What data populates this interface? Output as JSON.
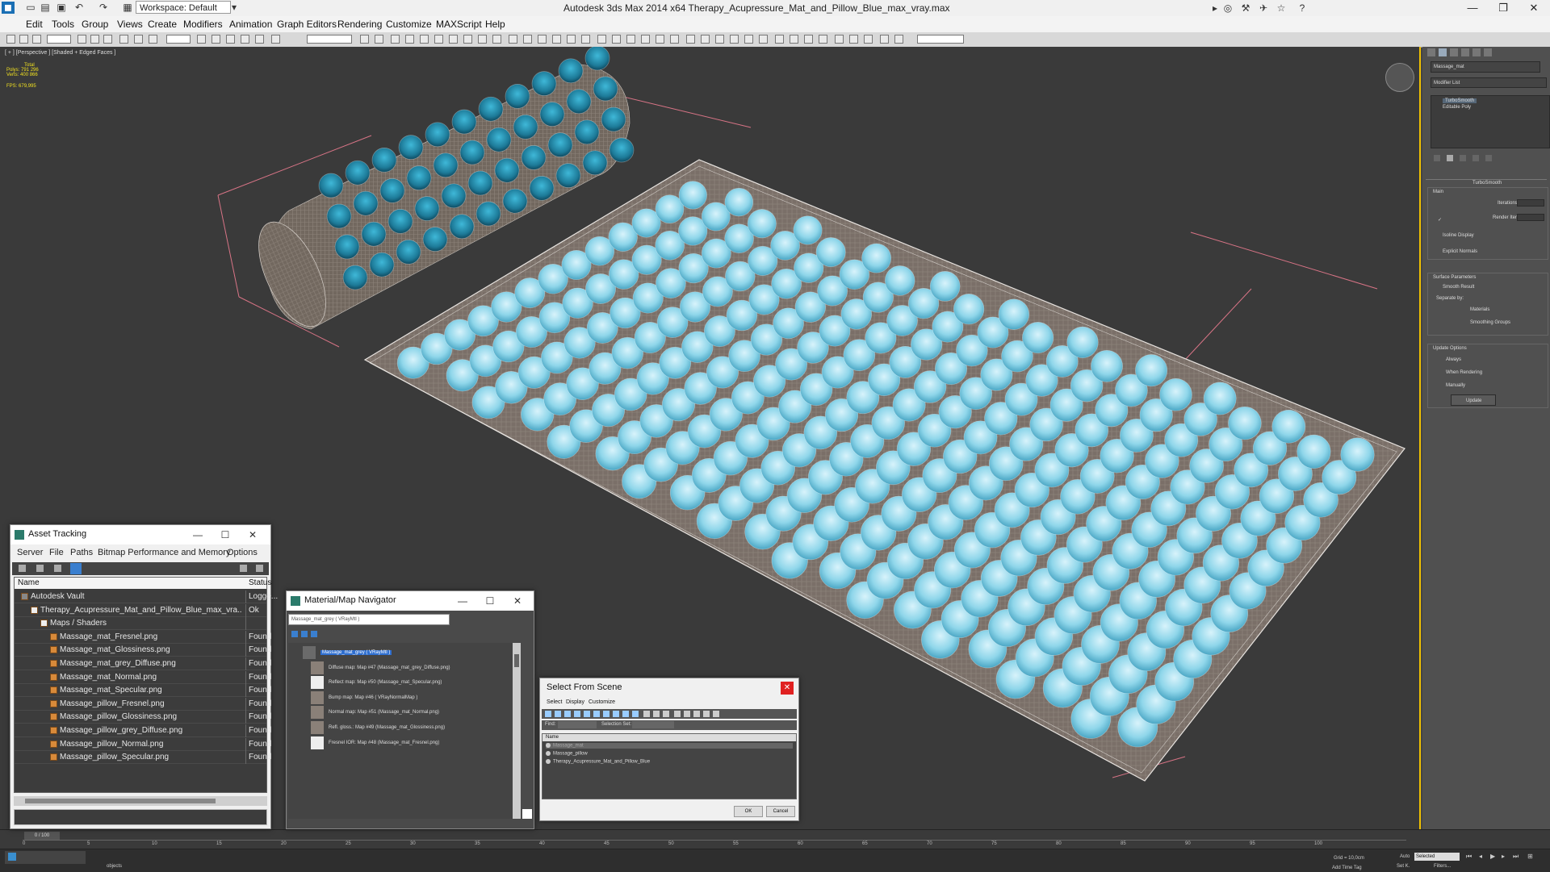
{
  "app": {
    "title": "Autodesk 3ds Max  2014 x64     Therapy_Acupressure_Mat_and_Pillow_Blue_max_vray.max",
    "workspace": "Workspace: Default"
  },
  "menu": [
    "Edit",
    "Tools",
    "Group",
    "Views",
    "Create",
    "Modifiers",
    "Animation",
    "Graph Editors",
    "Rendering",
    "Customize",
    "MAXScript",
    "Help"
  ],
  "viewport": {
    "label": "[ + ] [Perspective ] [Shaded + Edged Faces ]",
    "stats": {
      "total_label": "Total",
      "polys_label": "Polys:",
      "polys": "791 296",
      "verts_label": "Verts:",
      "verts": "400 866",
      "fps_label": "FPS:",
      "fps": "679,995"
    },
    "colors": {
      "bg": "#3a3a3a",
      "spike": "#7fd3e8",
      "fabric": "#7d726a",
      "bbox": "#e07a8a"
    }
  },
  "right_panel": {
    "object_name": "Massage_mat",
    "modifier_list": "Modifier List",
    "stack": [
      "TurboSmooth",
      "Editable Poly"
    ],
    "rollout_title": "TurboSmooth",
    "main": "Main",
    "iterations_label": "Iterations:",
    "render_iters_label": "Render Iters:",
    "isoline": "Isoline Display",
    "explicit": "Explicit Normals",
    "surface": "Surface Parameters",
    "smooth_result": "Smooth Result",
    "separate_by": "Separate by:",
    "materials": "Materials",
    "smoothing_groups": "Smoothing Groups",
    "update_options": "Update Options",
    "always": "Always",
    "when_rendering": "When Rendering",
    "manually": "Manually",
    "update_button": "Update"
  },
  "asset_tracking": {
    "title": "Asset Tracking",
    "menu": [
      "Server",
      "File",
      "Paths",
      "Bitmap Performance and Memory",
      "Options"
    ],
    "col_name": "Name",
    "col_status": "Status",
    "rows": [
      {
        "name": "Autodesk Vault",
        "status": "Logge...",
        "indent": 0
      },
      {
        "name": "Therapy_Acupressure_Mat_and_Pillow_Blue_max_vra...",
        "status": "Ok",
        "indent": 1
      },
      {
        "name": "Maps / Shaders",
        "status": "",
        "indent": 2
      },
      {
        "name": "Massage_mat_Fresnel.png",
        "status": "Found",
        "indent": 3
      },
      {
        "name": "Massage_mat_Glossiness.png",
        "status": "Found",
        "indent": 3
      },
      {
        "name": "Massage_mat_grey_Diffuse.png",
        "status": "Found",
        "indent": 3
      },
      {
        "name": "Massage_mat_Normal.png",
        "status": "Found",
        "indent": 3
      },
      {
        "name": "Massage_mat_Specular.png",
        "status": "Found",
        "indent": 3
      },
      {
        "name": "Massage_pillow_Fresnel.png",
        "status": "Found",
        "indent": 3
      },
      {
        "name": "Massage_pillow_Glossiness.png",
        "status": "Found",
        "indent": 3
      },
      {
        "name": "Massage_pillow_grey_Diffuse.png",
        "status": "Found",
        "indent": 3
      },
      {
        "name": "Massage_pillow_Normal.png",
        "status": "Found",
        "indent": 3
      },
      {
        "name": "Massage_pillow_Specular.png",
        "status": "Found",
        "indent": 3
      }
    ]
  },
  "material_navigator": {
    "title": "Material/Map Navigator",
    "slot": "Massage_mat_grey  ( VRayMtl )",
    "items": [
      "Massage_mat_grey  ( VRayMtl )",
      "Diffuse map: Map #47 (Massage_mat_grey_Diffuse.png)",
      "Reflect map: Map #50 (Massage_mat_Specular.png)",
      "Bump map: Map #46  ( VRayNormalMap )",
      "Normal map: Map #51 (Massage_mat_Normal.png)",
      "Refl. gloss.: Map #49 (Massage_mat_Glossiness.png)",
      "Fresnel IOR: Map #48 (Massage_mat_Fresnel.png)"
    ]
  },
  "select_from_scene": {
    "title": "Select From Scene",
    "menu": [
      "Select",
      "Display",
      "Customize"
    ],
    "find_label": "Find:",
    "selection_set_label": "Selection Set:",
    "col_name": "Name",
    "items": [
      "Massage_mat",
      "Massage_pillow",
      "Therapy_Acupressure_Mat_and_Pillow_Blue"
    ],
    "ok": "OK",
    "cancel": "Cancel"
  },
  "timeline": {
    "frame": "0 / 100",
    "ticks": [
      "0",
      "5",
      "10",
      "15",
      "20",
      "25",
      "30",
      "35",
      "40",
      "45",
      "50",
      "55",
      "60",
      "65",
      "70",
      "75",
      "80",
      "85",
      "90",
      "95",
      "100"
    ]
  },
  "status": {
    "left": "objects",
    "grid": "Grid = 10,0cm",
    "auto": "Auto",
    "selected": "Selected",
    "add_time_tag": "Add Time Tag",
    "setk": "Set K.",
    "filters": "Filters..."
  }
}
